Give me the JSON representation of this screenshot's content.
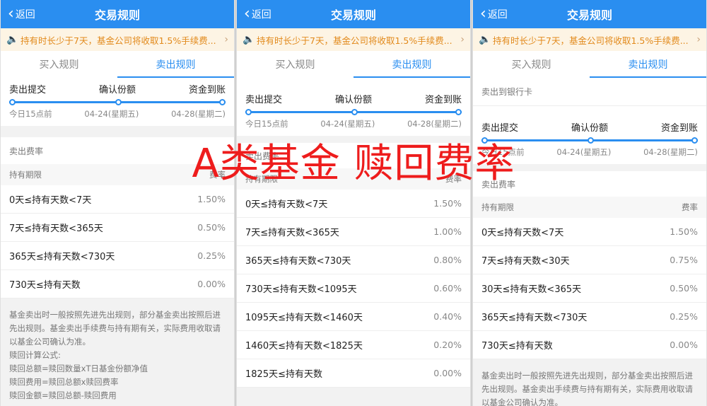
{
  "panels": [
    {
      "back": "返回",
      "title": "交易规则",
      "notice": "持有时长少于7天，基金公司将收取1.5%手续费...",
      "tabs": [
        "买入规则",
        "卖出规则"
      ],
      "steps": [
        "卖出提交",
        "确认份额",
        "资金到账"
      ],
      "dates": [
        "今日15点前",
        "04-24(星期五)",
        "04-28(星期二)"
      ],
      "fee_title": "卖出费率",
      "col_period": "持有期限",
      "col_rate": "费率",
      "rows": [
        {
          "k": "0天≤持有天数<7天",
          "v": "1.50%"
        },
        {
          "k": "7天≤持有天数<365天",
          "v": "0.50%"
        },
        {
          "k": "365天≤持有天数<730天",
          "v": "0.25%"
        },
        {
          "k": "730天≤持有天数",
          "v": "0.00%"
        }
      ],
      "notes": [
        "基金卖出时一般按照先进先出规则，部分基金卖出按照后进先出规则。基金卖出手续费与持有期有关，实际费用收取请以基金公司确认为准。",
        "赎回计算公式:",
        "赎回总额=赎回数量xT日基金份额净值",
        "赎回费用=赎回总额x赎回费率",
        "赎回金额=赎回总额-赎回费用"
      ]
    },
    {
      "back": "返回",
      "title": "交易规则",
      "notice": "持有时长少于7天，基金公司将收取1.5%手续费...",
      "tabs": [
        "买入规则",
        "卖出规则"
      ],
      "steps": [
        "卖出提交",
        "确认份额",
        "资金到账"
      ],
      "dates": [
        "今日15点前",
        "04-24(星期五)",
        "04-28(星期二)"
      ],
      "fee_title": "卖出费率",
      "col_period": "持有期限",
      "col_rate": "费率",
      "rows": [
        {
          "k": "0天≤持有天数<7天",
          "v": "1.50%"
        },
        {
          "k": "7天≤持有天数<365天",
          "v": "1.00%"
        },
        {
          "k": "365天≤持有天数<730天",
          "v": "0.80%"
        },
        {
          "k": "730天≤持有天数<1095天",
          "v": "0.60%"
        },
        {
          "k": "1095天≤持有天数<1460天",
          "v": "0.40%"
        },
        {
          "k": "1460天≤持有天数<1825天",
          "v": "0.20%"
        },
        {
          "k": "1825天≤持有天数",
          "v": "0.00%"
        }
      ]
    },
    {
      "back": "返回",
      "title": "交易规则",
      "notice": "持有时长少于7天，基金公司将收取1.5%手续费...",
      "tabs": [
        "买入规则",
        "卖出规则"
      ],
      "bank_label": "卖出到银行卡",
      "steps": [
        "卖出提交",
        "确认份额",
        "资金到账"
      ],
      "dates": [
        "今日15点前",
        "04-24(星期五)",
        "04-28(星期二)"
      ],
      "fee_title": "卖出费率",
      "col_period": "持有期限",
      "col_rate": "费率",
      "rows": [
        {
          "k": "0天≤持有天数<7天",
          "v": "1.50%"
        },
        {
          "k": "7天≤持有天数<30天",
          "v": "0.75%"
        },
        {
          "k": "30天≤持有天数<365天",
          "v": "0.50%"
        },
        {
          "k": "365天≤持有天数<730天",
          "v": "0.25%"
        },
        {
          "k": "730天≤持有天数",
          "v": "0.00%"
        }
      ],
      "notes": [
        "基金卖出时一般按照先进先出规则，部分基金卖出按照后进先出规则。基金卖出手续费与持有期有关，实际费用收取请以基金公司确认为准。"
      ]
    }
  ],
  "overlay_text": "A类基金 赎回费率",
  "colors": {
    "brand": "#2a8ef0",
    "notice": "#e28a1c",
    "overlay": "#ee1c1c"
  }
}
